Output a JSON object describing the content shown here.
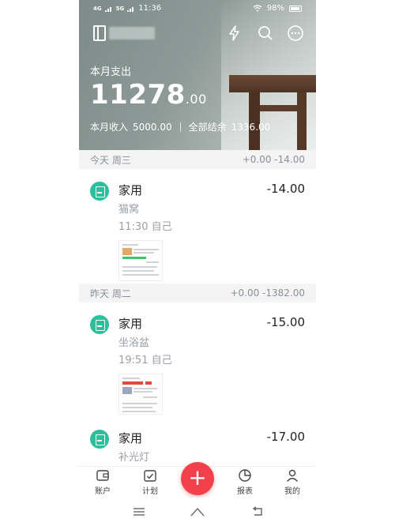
{
  "status_bar": {
    "signal1": "4G",
    "signal2": "5G",
    "time": "11:36",
    "battery": "98%"
  },
  "header": {
    "month_expense_label": "本月支出",
    "month_expense_int": "11278",
    "month_expense_dec": ".00",
    "income_label": "本月收入",
    "income_value": "5000.00",
    "balance_label": "全部结余",
    "balance_value": "1336.00"
  },
  "days": [
    {
      "label": "今天 周三",
      "summary": "+0.00 -14.00",
      "entries": [
        {
          "category": "家用",
          "amount": "-14.00",
          "note": "猫窝",
          "meta": "11:30 自己"
        }
      ]
    },
    {
      "label": "昨天 周二",
      "summary": "+0.00 -1382.00",
      "entries": [
        {
          "category": "家用",
          "amount": "-15.00",
          "note": "坐浴盆",
          "meta": "19:51 自己"
        },
        {
          "category": "家用",
          "amount": "-17.00",
          "note": "补光灯"
        }
      ]
    }
  ],
  "bottom_nav": {
    "accounts": "账户",
    "plan": "计划",
    "add": "+",
    "reports": "报表",
    "mine": "我的"
  },
  "colors": {
    "accent_red": "#f2414b",
    "category_green": "#2bbf9b"
  }
}
